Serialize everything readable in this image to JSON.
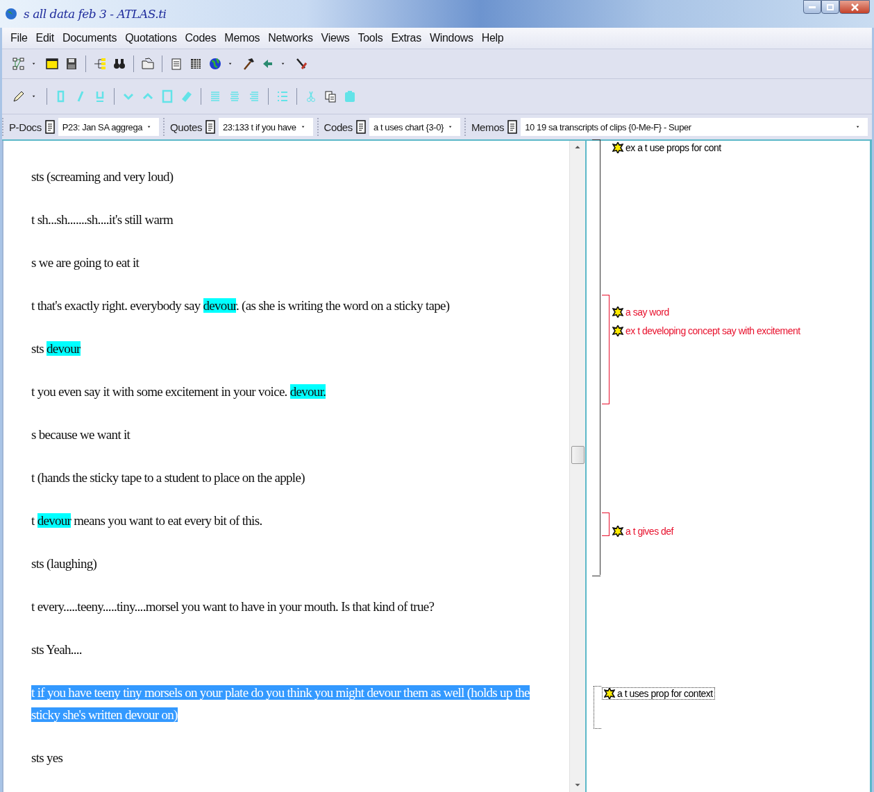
{
  "window": {
    "title": "s all data feb 3 - ATLAS.ti"
  },
  "menu": [
    "File",
    "Edit",
    "Documents",
    "Quotations",
    "Codes",
    "Memos",
    "Networks",
    "Views",
    "Tools",
    "Extras",
    "Windows",
    "Help"
  ],
  "selectors": [
    {
      "label": "P-Docs",
      "value": "P23: Jan SA aggrega"
    },
    {
      "label": "Quotes",
      "value": "23:133 t if you have"
    },
    {
      "label": "Codes",
      "value": "a t uses chart {3-0}"
    },
    {
      "label": "Memos",
      "value": "10 19 sa transcripts of clips {0-Me-F} - Super"
    }
  ],
  "document": {
    "paragraphs": [
      {
        "selected": false,
        "segments": [
          {
            "text": "sts (screaming and very loud)",
            "highlight": false
          }
        ]
      },
      {
        "selected": false,
        "segments": [
          {
            "text": "t sh...sh.......sh....it's still warm",
            "highlight": false
          }
        ]
      },
      {
        "selected": false,
        "segments": [
          {
            "text": "s we are going to eat it",
            "highlight": false
          }
        ]
      },
      {
        "selected": false,
        "segments": [
          {
            "text": "t that's exactly right. everybody say ",
            "highlight": false
          },
          {
            "text": "devour",
            "highlight": true
          },
          {
            "text": ". (as she is writing the word on a sticky tape)",
            "highlight": false
          }
        ]
      },
      {
        "selected": false,
        "segments": [
          {
            "text": "sts ",
            "highlight": false
          },
          {
            "text": "devour",
            "highlight": true
          }
        ]
      },
      {
        "selected": false,
        "segments": [
          {
            "text": "t you even say it with some excitement in your voice. ",
            "highlight": false
          },
          {
            "text": "devour.",
            "highlight": true
          }
        ]
      },
      {
        "selected": false,
        "segments": [
          {
            "text": "s because we want it",
            "highlight": false
          }
        ]
      },
      {
        "selected": false,
        "segments": [
          {
            "text": "t (hands the sticky tape to a student to place on the apple)",
            "highlight": false
          }
        ]
      },
      {
        "selected": false,
        "segments": [
          {
            "text": "t ",
            "highlight": false
          },
          {
            "text": "devour",
            "highlight": true
          },
          {
            "text": " means you want to eat every bit of this.",
            "highlight": false
          }
        ]
      },
      {
        "selected": false,
        "segments": [
          {
            "text": "sts (laughing)",
            "highlight": false
          }
        ]
      },
      {
        "selected": false,
        "segments": [
          {
            "text": "t every.....teeny.....tiny....morsel you want to have in your mouth. Is that kind of true?",
            "highlight": false
          }
        ]
      },
      {
        "selected": false,
        "segments": [
          {
            "text": "sts Yeah....",
            "highlight": false
          }
        ]
      },
      {
        "selected": true,
        "segments": [
          {
            "text": "t if you have teeny tiny morsels on your plate do you think you might devour them as well (holds up the sticky she's written devour on)",
            "highlight": false
          }
        ]
      },
      {
        "selected": false,
        "segments": [
          {
            "text": "sts yes",
            "highlight": false
          }
        ]
      }
    ]
  },
  "margin": {
    "codes": [
      {
        "text": "ex a t use props for  cont",
        "color": "#000000",
        "selected": false
      },
      {
        "text": "a say word",
        "color": "#e8112d",
        "selected": false
      },
      {
        "text": "ex t developing concept say with excitement",
        "color": "#e8112d",
        "selected": false
      },
      {
        "text": "a t gives def",
        "color": "#e8112d",
        "selected": false
      },
      {
        "text": "a t uses prop for context",
        "color": "#000000",
        "selected": true
      }
    ]
  }
}
